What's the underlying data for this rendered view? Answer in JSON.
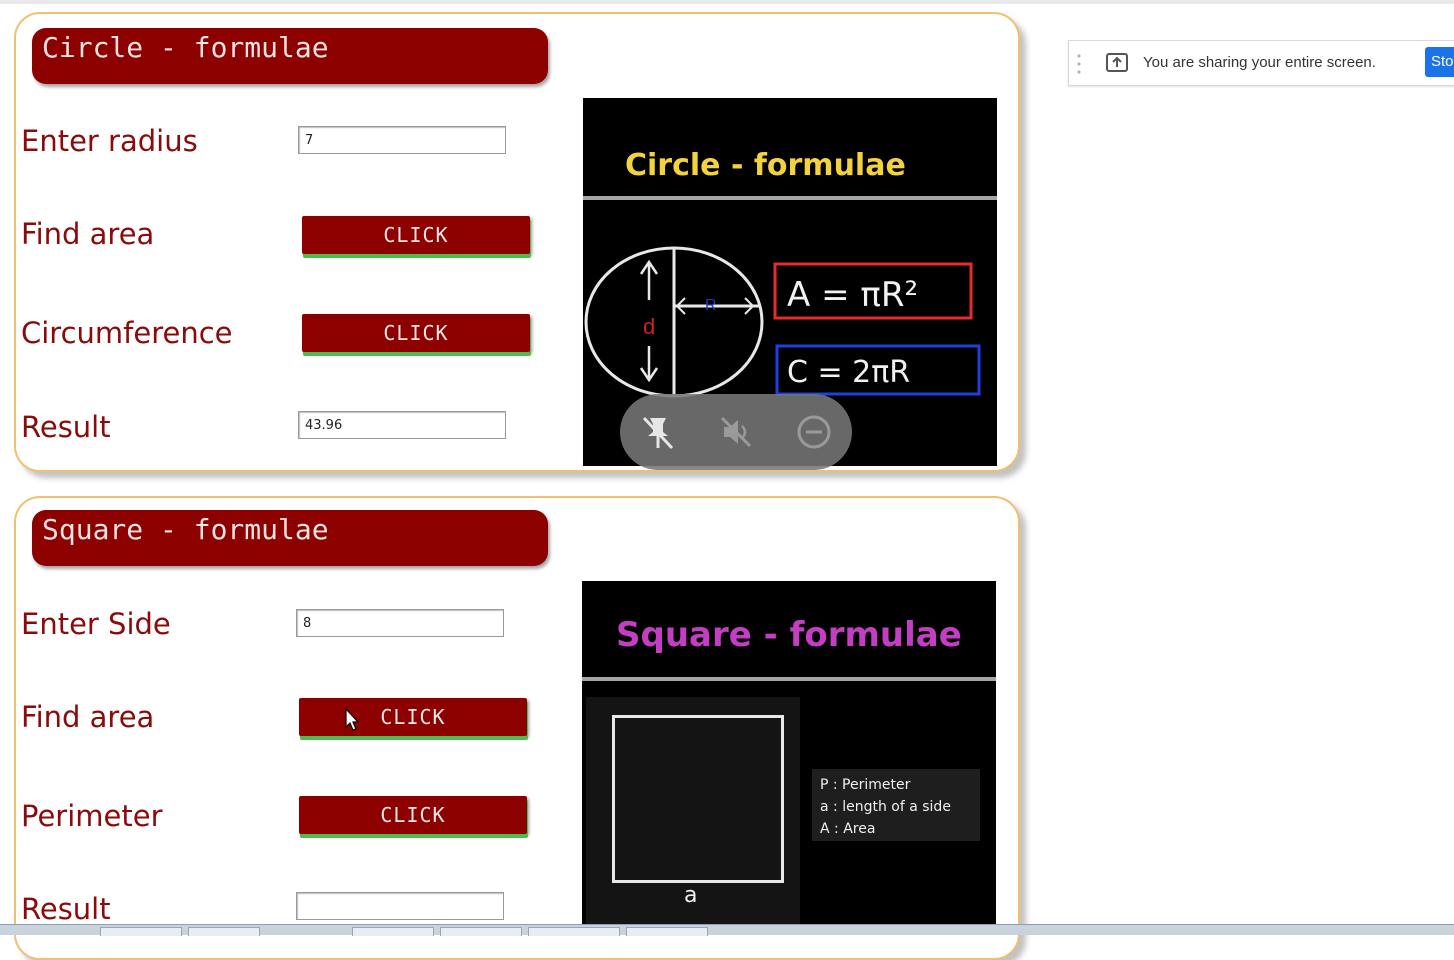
{
  "circle_section": {
    "title": "Circle - formulae",
    "radius_label": "Enter radius",
    "radius_value": "7",
    "area_label": "Find area",
    "area_button": "CLICK",
    "circumference_label": "Circumference",
    "circumference_button": "CLICK",
    "result_label": "Result",
    "result_value": "43.96",
    "image": {
      "title": "Circle - formulae",
      "radius_letter": "R",
      "diameter_letter": "d",
      "area_formula": "A = πR²",
      "circumference_formula": "C = 2πR"
    }
  },
  "square_section": {
    "title": "Square - formulae",
    "side_label": "Enter Side",
    "side_value": "8",
    "area_label": "Find area",
    "area_button": "CLICK",
    "perimeter_label": "Perimeter",
    "perimeter_button": "CLICK",
    "result_label": "Result",
    "result_value": "",
    "image": {
      "title": "Square - formulae",
      "side_letter": "a",
      "legend": [
        "P : Perimeter",
        "a : length of a side",
        "A : Area"
      ]
    }
  },
  "screen_share": {
    "message": "You are sharing your entire screen.",
    "stop_label": "Stop"
  },
  "overlay_controls": [
    "pin-icon",
    "mute-icon",
    "minimize-icon"
  ],
  "colors": {
    "maroon": "#8d0000",
    "card_border": "#f0c070",
    "label": "#8b0a0a",
    "circle_title": "#f3d23c",
    "square_title": "#c43ec4",
    "area_box": "#e52b2b",
    "circ_box": "#1f3fe0",
    "share_blue": "#1a73e8"
  }
}
